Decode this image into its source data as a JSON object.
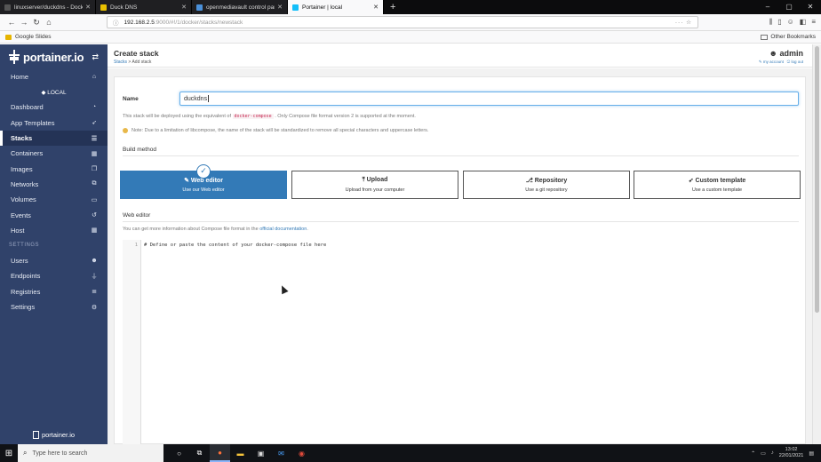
{
  "browser": {
    "tabs": [
      {
        "label": "linuxserver/duckdns - Docker",
        "favicon_color": "#555555",
        "active": false
      },
      {
        "label": "Duck DNS",
        "favicon_color": "#e8c000",
        "active": false
      },
      {
        "label": "openmediavault control panel",
        "favicon_color": "#4a90d9",
        "active": false
      },
      {
        "label": "Portainer | local",
        "favicon_color": "#13bef9",
        "active": true
      }
    ],
    "new_tab": "+",
    "url_host": "192.168.2.5",
    "url_rest": ":9000/#!/1/docker/stacks/newstack",
    "bookmarks": [
      {
        "label": "Google Slides"
      }
    ],
    "other_bookmarks": "Other Bookmarks"
  },
  "sidebar": {
    "logo": "portainer.io",
    "items_top": [
      {
        "label": "Home",
        "icon": "home-icon",
        "glyph": "⌂"
      }
    ],
    "env": "◆ LOCAL",
    "items_env": [
      {
        "label": "Dashboard",
        "icon": "tachometer-icon",
        "glyph": "◔",
        "active": false
      },
      {
        "label": "App Templates",
        "icon": "rocket-icon",
        "glyph": "➶",
        "active": false
      },
      {
        "label": "Stacks",
        "icon": "th-list-icon",
        "glyph": "☰",
        "active": true
      },
      {
        "label": "Containers",
        "icon": "cubes-icon",
        "glyph": "▦",
        "active": false
      },
      {
        "label": "Images",
        "icon": "clone-icon",
        "glyph": "❐",
        "active": false
      },
      {
        "label": "Networks",
        "icon": "sitemap-icon",
        "glyph": "⧉",
        "active": false
      },
      {
        "label": "Volumes",
        "icon": "hdd-icon",
        "glyph": "▭",
        "active": false
      },
      {
        "label": "Events",
        "icon": "history-icon",
        "glyph": "↺",
        "active": false
      },
      {
        "label": "Host",
        "icon": "th-icon",
        "glyph": "▦",
        "active": false
      }
    ],
    "settings_section": "SETTINGS",
    "items_settings": [
      {
        "label": "Users",
        "icon": "users-icon",
        "glyph": "☻"
      },
      {
        "label": "Endpoints",
        "icon": "plug-icon",
        "glyph": "⏚"
      },
      {
        "label": "Registries",
        "icon": "database-icon",
        "glyph": "≣"
      },
      {
        "label": "Settings",
        "icon": "cogs-icon",
        "glyph": "⚙"
      }
    ],
    "footer_logo": "portainer.io"
  },
  "header": {
    "title": "Create stack",
    "breadcrumb_link": "Stacks",
    "breadcrumb_current": "Add stack",
    "user": "admin",
    "my_account": "my account",
    "log_out": "log out"
  },
  "form": {
    "name_label": "Name",
    "name_value": "duckdns",
    "help_pre": "This stack will be deployed using the equivalent of",
    "help_code": "docker-compose",
    "help_post": ". Only Compose file format version 2 is supported at the moment.",
    "note": "Note: Due to a limitation of libcompose, the name of the stack will be standardized to remove all special characters and uppercase letters.",
    "build_method_title": "Build method",
    "methods": [
      {
        "title": "Web editor",
        "desc": "Use our Web editor",
        "icon": "edit-icon",
        "glyph": "✎",
        "selected": true
      },
      {
        "title": "Upload",
        "desc": "Upload from your computer",
        "icon": "upload-icon",
        "glyph": "⤒",
        "selected": false
      },
      {
        "title": "Repository",
        "desc": "Use a git repository",
        "icon": "git-icon",
        "glyph": "⎇",
        "selected": false
      },
      {
        "title": "Custom template",
        "desc": "Use a custom template",
        "icon": "rocket-icon",
        "glyph": "➶",
        "selected": false
      }
    ],
    "web_editor_title": "Web editor",
    "doc_hint_pre": "You can get more information about Compose file format in the",
    "doc_hint_link": "official documentation",
    "doc_hint_post": ".",
    "editor_line_number": "1",
    "editor_content": "# Define or paste the content of your docker-compose file here"
  },
  "taskbar": {
    "search_placeholder": "Type here to search",
    "time": "13:02",
    "date": "22/01/2021"
  }
}
